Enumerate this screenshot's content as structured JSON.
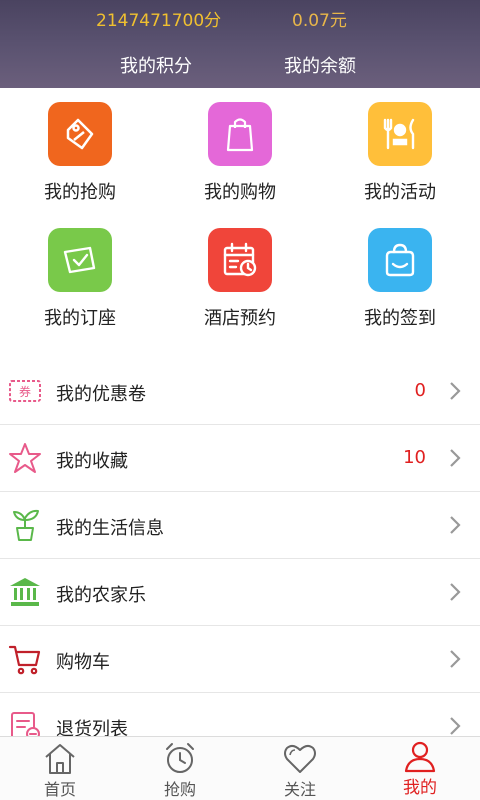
{
  "header": {
    "points_value": "2147471700分",
    "balance_value": "0.07元",
    "points_label": "我的积分",
    "balance_label": "我的余额"
  },
  "grid": [
    {
      "label": "我的抢购",
      "icon": "tag-icon",
      "color": "#f0661e"
    },
    {
      "label": "我的购物",
      "icon": "shopping-bag-icon",
      "color": "#e468d8"
    },
    {
      "label": "我的活动",
      "icon": "dining-icon",
      "color": "#ffbf3a"
    },
    {
      "label": "我的订座",
      "icon": "reserved-sign-icon",
      "color": "#79c94a"
    },
    {
      "label": "酒店预约",
      "icon": "calendar-icon",
      "color": "#f0453a"
    },
    {
      "label": "我的签到",
      "icon": "bag-checkin-icon",
      "color": "#3ab4f0"
    }
  ],
  "list": [
    {
      "label": "我的优惠卷",
      "count": "0",
      "icon": "coupon-icon"
    },
    {
      "label": "我的收藏",
      "count": "10",
      "icon": "star-icon"
    },
    {
      "label": "我的生活信息",
      "count": "",
      "icon": "sprout-icon"
    },
    {
      "label": "我的农家乐",
      "count": "",
      "icon": "bank-icon"
    },
    {
      "label": "购物车",
      "count": "",
      "icon": "cart-icon"
    },
    {
      "label": "退货列表",
      "count": "",
      "icon": "return-list-icon"
    }
  ],
  "tabs": [
    {
      "label": "首页",
      "icon": "home-icon"
    },
    {
      "label": "抢购",
      "icon": "alarm-clock-icon"
    },
    {
      "label": "关注",
      "icon": "heart-icon"
    },
    {
      "label": "我的",
      "icon": "user-icon",
      "active": true
    }
  ],
  "colors": {
    "accent": "#e02020",
    "points_text": "#f0c030"
  }
}
